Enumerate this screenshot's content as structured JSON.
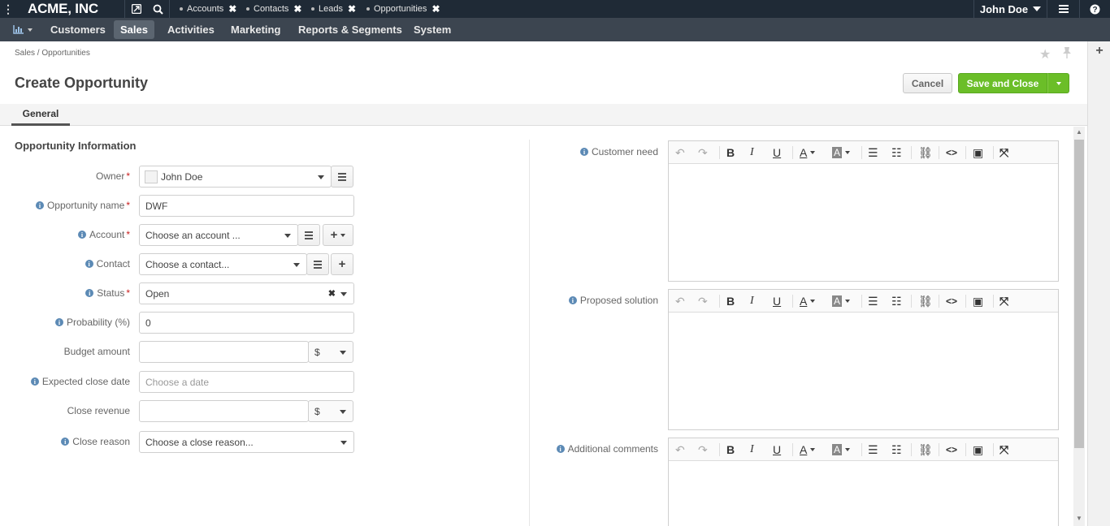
{
  "topbar": {
    "brand": "ACME, INC",
    "pinned_tabs": [
      {
        "label": "Accounts"
      },
      {
        "label": "Contacts"
      },
      {
        "label": "Leads"
      },
      {
        "label": "Opportunities"
      }
    ],
    "user": "John Doe"
  },
  "nav": {
    "items": [
      "Customers",
      "Sales",
      "Activities",
      "Marketing",
      "Reports & Segments",
      "System"
    ],
    "active": "Sales"
  },
  "breadcrumb": "Sales / Opportunities",
  "page_title": "Create Opportunity",
  "actions": {
    "cancel": "Cancel",
    "save": "Save and Close"
  },
  "tabs": {
    "general": "General"
  },
  "form": {
    "section_title": "Opportunity Information",
    "owner": {
      "label": "Owner",
      "value": "John Doe"
    },
    "name": {
      "label": "Opportunity name",
      "value": "DWF"
    },
    "account": {
      "label": "Account",
      "placeholder": "Choose an account ..."
    },
    "contact": {
      "label": "Contact",
      "placeholder": "Choose a contact..."
    },
    "status": {
      "label": "Status",
      "value": "Open"
    },
    "probability": {
      "label": "Probability (%)",
      "value": "0"
    },
    "budget": {
      "label": "Budget amount",
      "value": "",
      "currency": "$"
    },
    "close_date": {
      "label": "Expected close date",
      "placeholder": "Choose a date"
    },
    "close_revenue": {
      "label": "Close revenue",
      "value": "",
      "currency": "$"
    },
    "close_reason": {
      "label": "Close reason",
      "placeholder": "Choose a close reason..."
    }
  },
  "editors": {
    "customer_need": "Customer need",
    "proposed_solution": "Proposed solution",
    "additional_comments": "Additional comments"
  },
  "icons": {
    "menu": "vertical-dots-icon",
    "dashboard": "chart-icon",
    "search": "search-icon",
    "star": "star-icon",
    "pin": "pin-icon",
    "add": "plus-icon"
  },
  "colors": {
    "primary_button": "#6bbe28",
    "topbar": "#1f2a36",
    "navbar": "#3c4550",
    "required": "#c81d1d",
    "info": "#5c8ab5"
  }
}
